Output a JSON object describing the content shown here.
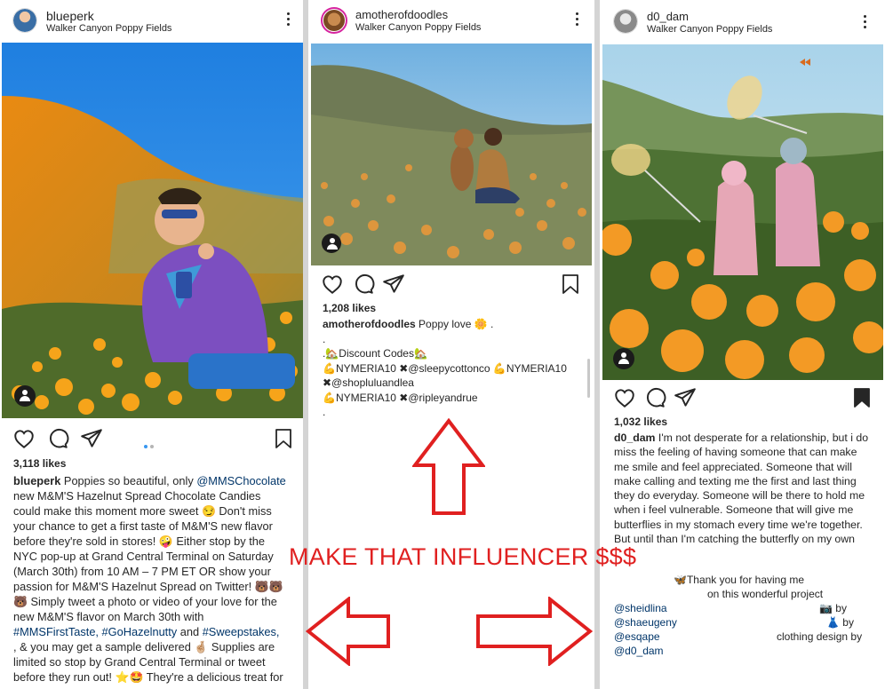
{
  "post1": {
    "username": "blueperk",
    "location": "Walker Canyon Poppy Fields",
    "likes": "3,118 likes",
    "caption_user": "blueperk",
    "caption_lines": [
      "Poppies so beautiful, only",
      "@MMSChocolate",
      "new M&M'S Hazelnut Spread Chocolate Candies",
      "could make this moment more sweet 😏 Don't miss",
      "your chance to get a first taste of M&M'S new flavor",
      "before they're sold in stores! 🤪 Either stop by the",
      "NYC pop-up at Grand Central Terminal on Saturday",
      "(March 30th) from 10 AM – 7 PM ET OR show your",
      "passion for M&M'S Hazelnut Spread on Twitter! 🐻🐻",
      "🐻 Simply tweet a photo or video of your love for the",
      "new M&M'S flavor on March 30th with",
      "#MMSFirstTaste, #GoHazelnutty",
      "and",
      "#Sweepstakes,",
      ", & you may get a sample delivered 🤞🏼 Supplies are",
      "limited so stop by Grand Central Terminal or tweet",
      "before they run out! ⭐🤩 They're a delicious treat for"
    ]
  },
  "post2": {
    "username": "amotherofdoodles",
    "location": "Walker Canyon Poppy Fields",
    "likes": "1,208 likes",
    "caption_user": "amotherofdoodles",
    "caption_text": "Poppy love 🌼 .",
    "dot1": ".",
    "discount_line": ".🏡Discount Codes🏡",
    "code_line1": "💪NYMERIA10 ✖@sleepycottonco 💪NYMERIA10",
    "code_line2": "✖@shopluluandlea",
    "code_line3": "💪NYMERIA10 ✖@ripleyandrue",
    "dot2": "."
  },
  "post3": {
    "username": "d0_dam",
    "location": "Walker Canyon Poppy Fields",
    "likes": "1,032 likes",
    "caption_user": "d0_dam",
    "caption_lines": [
      "I'm not desperate for a relationship, but i do",
      "miss the feeling of having someone that can make",
      "me smile and feel appreciated. Someone  that will",
      "make calling and texting me the first and last thing",
      "they do everyday. Someone will be there to hold me",
      "when i feel vulnerable. Someone that will give me",
      "butterflies in my stomach every time we're together.",
      "But until than I'm catching the butterfly on my own"
    ],
    "thanks_line1": "🦋Thank you for having me",
    "thanks_line2": "on this wonderful project",
    "credit1_handle": "@sheidlina",
    "credit1_suffix": "📷 by",
    "credit2_handle": "@shaeugeny",
    "credit2_suffix": "👗 by",
    "credit3_handle": "@esqape",
    "credit3_suffix": "clothing design by",
    "credit4_handle": "@d0_dam"
  },
  "overlay_text": "MAKE THAT INFLUENCER $$$",
  "colors": {
    "overlay_red": "#e02020",
    "mention_blue": "#003569",
    "ig_blue": "#3897f0"
  }
}
